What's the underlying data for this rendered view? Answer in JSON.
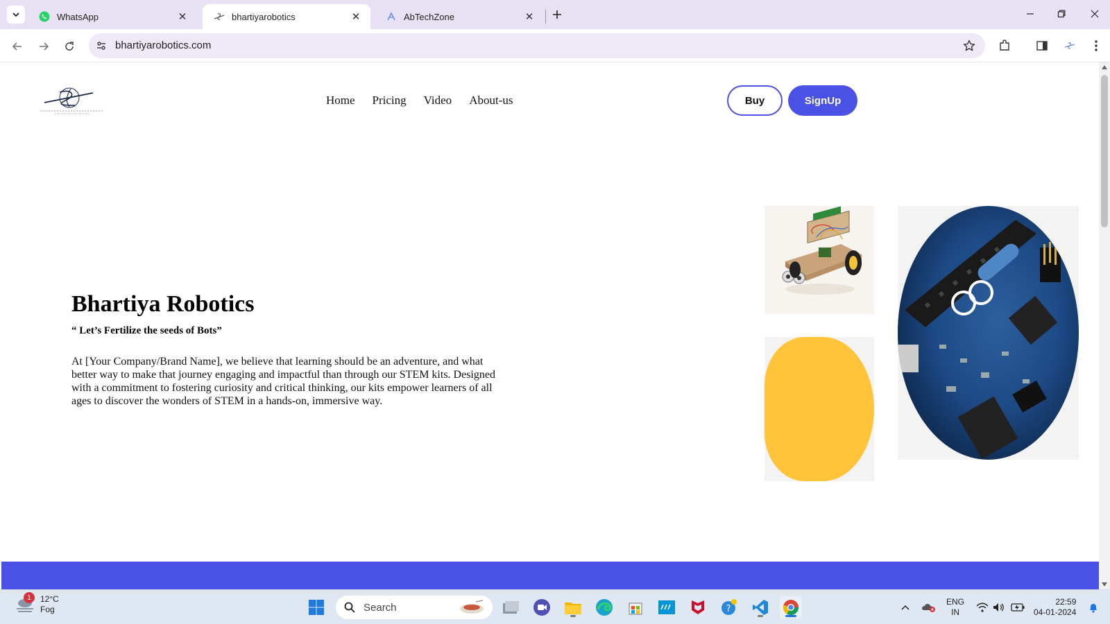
{
  "browser": {
    "tabs": [
      {
        "label": "WhatsApp",
        "icon": "whatsapp-icon",
        "active": false
      },
      {
        "label": "bhartiyarobotics",
        "icon": "site-favicon",
        "active": true
      },
      {
        "label": "AbTechZone",
        "icon": "site-favicon",
        "active": false
      }
    ],
    "close_glyph": "✕",
    "url": "bhartiyarobotics.com"
  },
  "site": {
    "nav": [
      "Home",
      "Pricing",
      "Video",
      "About-us"
    ],
    "buy_label": "Buy",
    "signup_label": "SignUp",
    "hero": {
      "title": "Bhartiya Robotics",
      "tagline": "“ Let’s Fertilize the seeds of Bots”",
      "description": "At [Your Company/Brand Name], we believe that learning should be an adventure, and what better way to make that journey engaging and impactful than through our STEM kits. Designed with a commitment to fostering curiosity and critical thinking, our kits empower learners of all ages to discover the wonders of STEM in a hands-on, immersive way."
    },
    "colors": {
      "accent": "#4a52e6",
      "yellow": "#ffc43a"
    }
  },
  "taskbar": {
    "weather": {
      "temp": "12°C",
      "condition": "Fog",
      "badge": "1"
    },
    "search_label": "Search",
    "lang_primary": "ENG",
    "lang_secondary": "IN",
    "time": "22:59",
    "date": "04-01-2024"
  }
}
